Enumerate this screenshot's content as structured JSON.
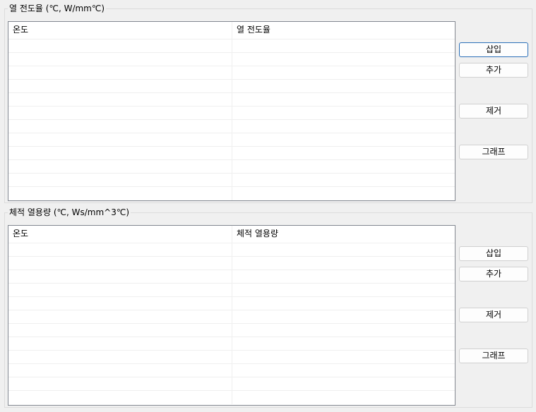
{
  "thermal_conductivity": {
    "legend": "열 전도율 (℃, W/mm℃)",
    "columns": [
      "온도",
      "열 전도율"
    ],
    "rows": [
      [
        "",
        ""
      ],
      [
        "",
        ""
      ],
      [
        "",
        ""
      ],
      [
        "",
        ""
      ],
      [
        "",
        ""
      ],
      [
        "",
        ""
      ],
      [
        "",
        ""
      ],
      [
        "",
        ""
      ],
      [
        "",
        ""
      ],
      [
        "",
        ""
      ],
      [
        "",
        ""
      ],
      [
        "",
        ""
      ]
    ],
    "buttons": {
      "insert": "삽입",
      "add": "추가",
      "remove": "제거",
      "graph": "그래프"
    }
  },
  "volumetric_heat_capacity": {
    "legend": "체적 열용량 (℃, Ws/mm^3℃)",
    "columns": [
      "온도",
      "체적 열용량"
    ],
    "rows": [
      [
        "",
        ""
      ],
      [
        "",
        ""
      ],
      [
        "",
        ""
      ],
      [
        "",
        ""
      ],
      [
        "",
        ""
      ],
      [
        "",
        ""
      ],
      [
        "",
        ""
      ],
      [
        "",
        ""
      ],
      [
        "",
        ""
      ],
      [
        "",
        ""
      ],
      [
        "",
        ""
      ],
      [
        "",
        ""
      ]
    ],
    "buttons": {
      "insert": "삽입",
      "add": "추가",
      "remove": "제거",
      "graph": "그래프"
    }
  }
}
